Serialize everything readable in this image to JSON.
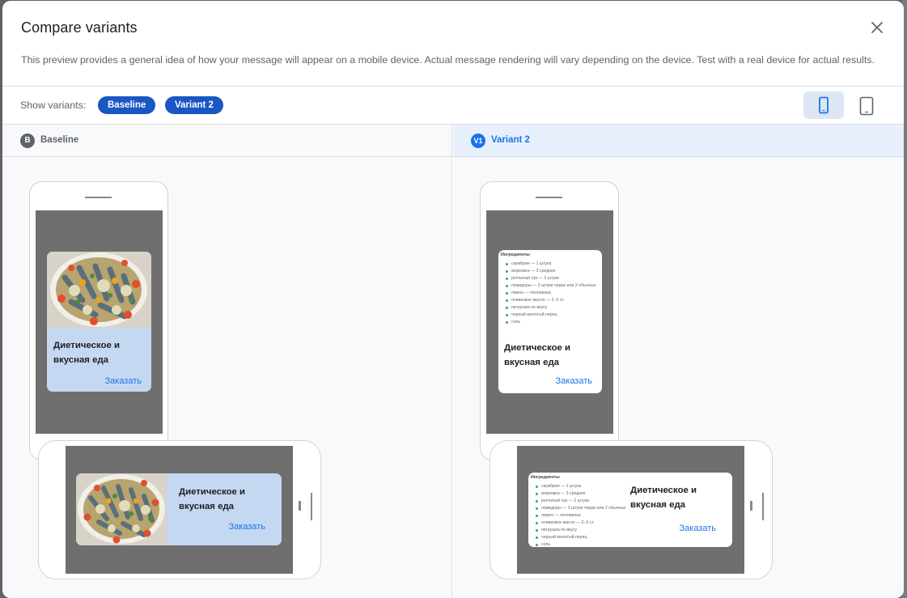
{
  "dialog": {
    "title": "Compare variants",
    "description": "This preview provides a general idea of how your message will appear on a mobile device. Actual message rendering will vary depending on the device. Test with a real device for actual results."
  },
  "toolbar": {
    "show_variants_label": "Show variants:",
    "chips": [
      "Baseline",
      "Variant 2"
    ],
    "device_buttons": [
      {
        "icon": "smartphone-icon",
        "selected": true
      },
      {
        "icon": "tablet-icon",
        "selected": false
      }
    ]
  },
  "columns": {
    "baseline": {
      "badge": "B",
      "name": "Baseline"
    },
    "variant": {
      "badge": "V1",
      "name": "Variant 2"
    }
  },
  "message": {
    "title": "Диетическое и\nвкусная еда",
    "action_label": "Заказать",
    "image_icon": "food-dish-image"
  },
  "ingredients": {
    "title": "Ингредиенты",
    "items": [
      "скумбрия — 1 штука",
      "морковка — 3 средних",
      "репчатый лук — 2 штуки",
      "помидоры — 3 штуки черри или 2 обычных",
      "лимон — половинка",
      "оливковое масло — 2–3 ст.",
      "петрушка по вкусу",
      "черный молотый перец",
      "соль"
    ]
  },
  "colors": {
    "chip_blue": "#1a56c4",
    "accent_blue": "#1a73e8",
    "card_light_blue": "#c5d8f2",
    "screen_gray": "#6f6f6f"
  }
}
